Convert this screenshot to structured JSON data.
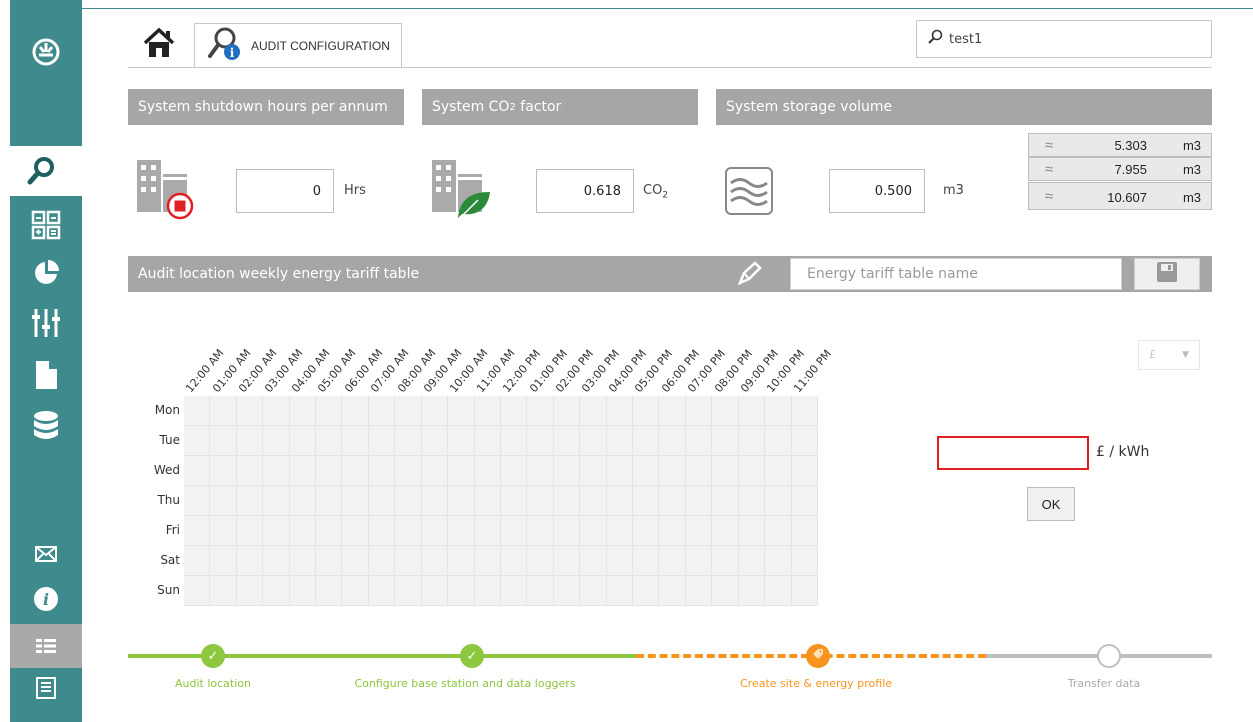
{
  "colors": {
    "teal": "#3f8a8c",
    "header_gray": "#a6a6a6",
    "done_green": "#8dc63f",
    "active_orange": "#f7941d",
    "pending_gray": "#bfbfbf",
    "error_red": "#e02020"
  },
  "sidebar": {
    "items": [
      {
        "icon": "dashboard-icon"
      },
      {
        "icon": "search-icon"
      },
      {
        "icon": "calculator-icon"
      },
      {
        "icon": "pie-chart-icon"
      },
      {
        "icon": "sliders-icon"
      },
      {
        "icon": "document-icon"
      },
      {
        "icon": "database-icon"
      },
      {
        "icon": "mail-icon"
      },
      {
        "icon": "info-icon"
      },
      {
        "icon": "grid-menu-icon"
      },
      {
        "icon": "report-icon"
      }
    ]
  },
  "topbar": {
    "tab_label": "AUDIT CONFIGURATION",
    "search_value": "test1"
  },
  "sections": {
    "shutdown": {
      "title": "System shutdown hours per annum",
      "value": "0",
      "unit": "Hrs"
    },
    "co2": {
      "title_prefix": "System CO",
      "title_sub": "2",
      "title_suffix": " factor",
      "value": "0.618",
      "unit_main": "CO",
      "unit_sub": "2"
    },
    "storage": {
      "title": "System storage volume",
      "value": "0.500",
      "unit": "m3",
      "options": [
        {
          "value": "5.303",
          "unit": "m3"
        },
        {
          "value": "7.955",
          "unit": "m3"
        },
        {
          "value": "10.607",
          "unit": "m3"
        }
      ]
    }
  },
  "tariff": {
    "title": "Audit location weekly energy tariff table",
    "name_placeholder": "Energy tariff table name",
    "hours": [
      "12:00 AM",
      "01:00 AM",
      "02:00 AM",
      "03:00 AM",
      "04:00 AM",
      "05:00 AM",
      "06:00 AM",
      "07:00 AM",
      "08:00 AM",
      "09:00 AM",
      "10:00 AM",
      "11:00 AM",
      "12:00 PM",
      "01:00 PM",
      "02:00 PM",
      "03:00 PM",
      "04:00 PM",
      "05:00 PM",
      "06:00 PM",
      "07:00 PM",
      "08:00 PM",
      "09:00 PM",
      "10:00 PM",
      "11:00 PM"
    ],
    "days": [
      "Mon",
      "Tue",
      "Wed",
      "Thu",
      "Fri",
      "Sat",
      "Sun"
    ],
    "currency": "£",
    "rate_value": "",
    "rate_unit": "£ / kWh",
    "ok_label": "OK"
  },
  "steps": [
    {
      "label": "Audit location",
      "status": "done"
    },
    {
      "label": "Configure base station and data loggers",
      "status": "done"
    },
    {
      "label": "Create site & energy profile",
      "status": "active"
    },
    {
      "label": "Transfer data",
      "status": "pending"
    }
  ]
}
